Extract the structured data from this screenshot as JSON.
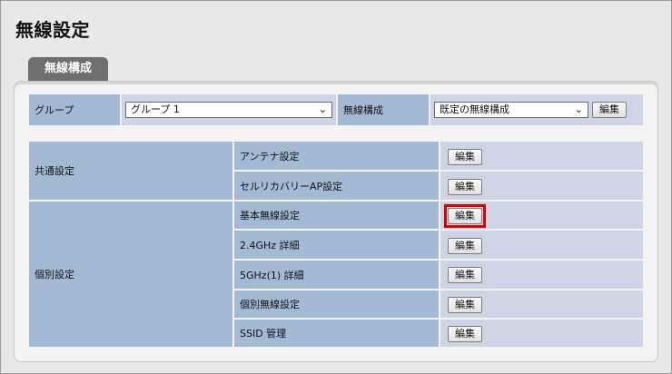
{
  "page": {
    "title": "無線設定"
  },
  "tab": {
    "label": "無線構成"
  },
  "header_row": {
    "group_label": "グループ",
    "group_value": "グループ 1",
    "config_label": "無線構成",
    "config_value": "既定の無線構成",
    "edit_label": "編集"
  },
  "table": {
    "sections": [
      {
        "label": "共通設定",
        "rows": [
          {
            "label": "アンテナ設定",
            "button": "編集"
          },
          {
            "label": "セルリカバリーAP設定",
            "button": "編集"
          }
        ]
      },
      {
        "label": "個別設定",
        "rows": [
          {
            "label": "基本無線設定",
            "button": "編集"
          },
          {
            "label": "2.4GHz 詳細",
            "button": "編集"
          },
          {
            "label": "5GHz(1) 詳細",
            "button": "編集"
          },
          {
            "label": "個別無線設定",
            "button": "編集"
          },
          {
            "label": "SSID 管理",
            "button": "編集"
          }
        ]
      }
    ]
  },
  "highlight_color": "#e00000"
}
